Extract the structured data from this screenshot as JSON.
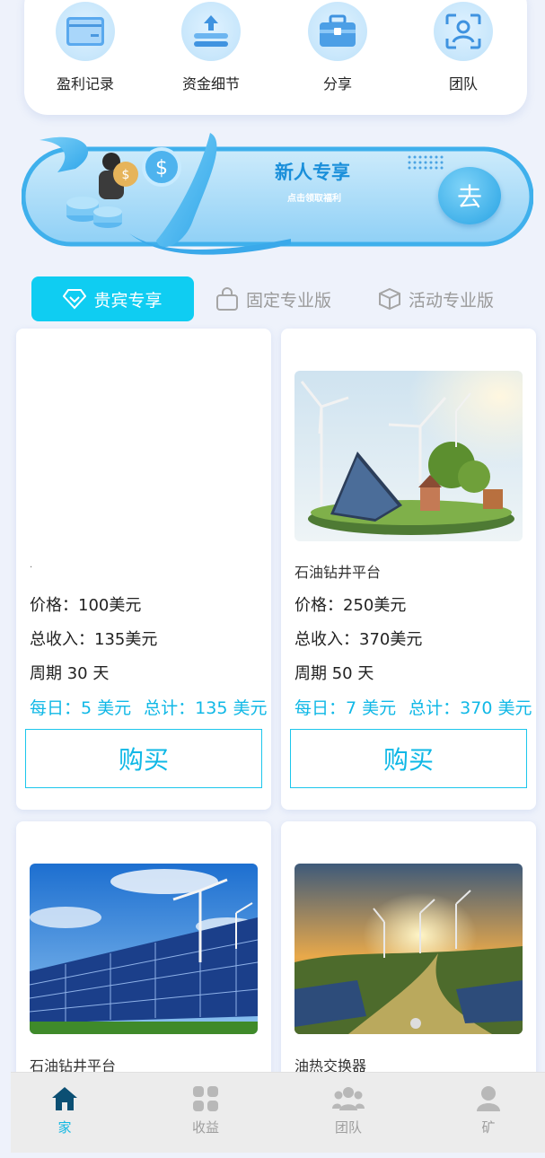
{
  "shortcuts": [
    {
      "label": "盈利记录",
      "icon": "wallet-icon"
    },
    {
      "label": "资金细节",
      "icon": "upload-stack-icon"
    },
    {
      "label": "分享",
      "icon": "briefcase-icon"
    },
    {
      "label": "团队",
      "icon": "user-scan-icon"
    }
  ],
  "banner": {
    "title": "新人专享",
    "subtitle": "点击领取福利",
    "go_label": "去"
  },
  "tabs": [
    {
      "label": "贵宾专享",
      "icon": "diamond-icon",
      "active": true
    },
    {
      "label": "固定专业版",
      "icon": "shopping-bag-icon",
      "active": false
    },
    {
      "label": "活动专业版",
      "icon": "box-icon",
      "active": false
    }
  ],
  "products": [
    {
      "name": ".",
      "price": "价格：100美元",
      "total_income": "总收入：135美元",
      "period": "周期 30 天",
      "daily": "每日：5 美元",
      "total": "总计：135 美元",
      "buy_label": "购买",
      "has_image": false
    },
    {
      "name": "石油钻井平台",
      "price": "价格：250美元",
      "total_income": "总收入：370美元",
      "period": "周期 50 天",
      "daily": "每日：7 美元",
      "total": "总计：370 美元",
      "buy_label": "购买",
      "has_image": true
    },
    {
      "name": "石油钻井平台",
      "has_image": true
    },
    {
      "name": "油热交换器",
      "has_image": true
    }
  ],
  "bottom_nav": [
    {
      "label": "家",
      "icon": "home-icon",
      "active": true
    },
    {
      "label": "收益",
      "icon": "grid-icon",
      "active": false
    },
    {
      "label": "团队",
      "icon": "users-icon",
      "active": false
    },
    {
      "label": "矿",
      "icon": "user-icon",
      "active": false
    }
  ],
  "colors": {
    "accent": "#0fcdf2",
    "accent_text": "#10b8e6",
    "page_bg": "#eef2fb",
    "nav_active": "#0b4f73"
  }
}
